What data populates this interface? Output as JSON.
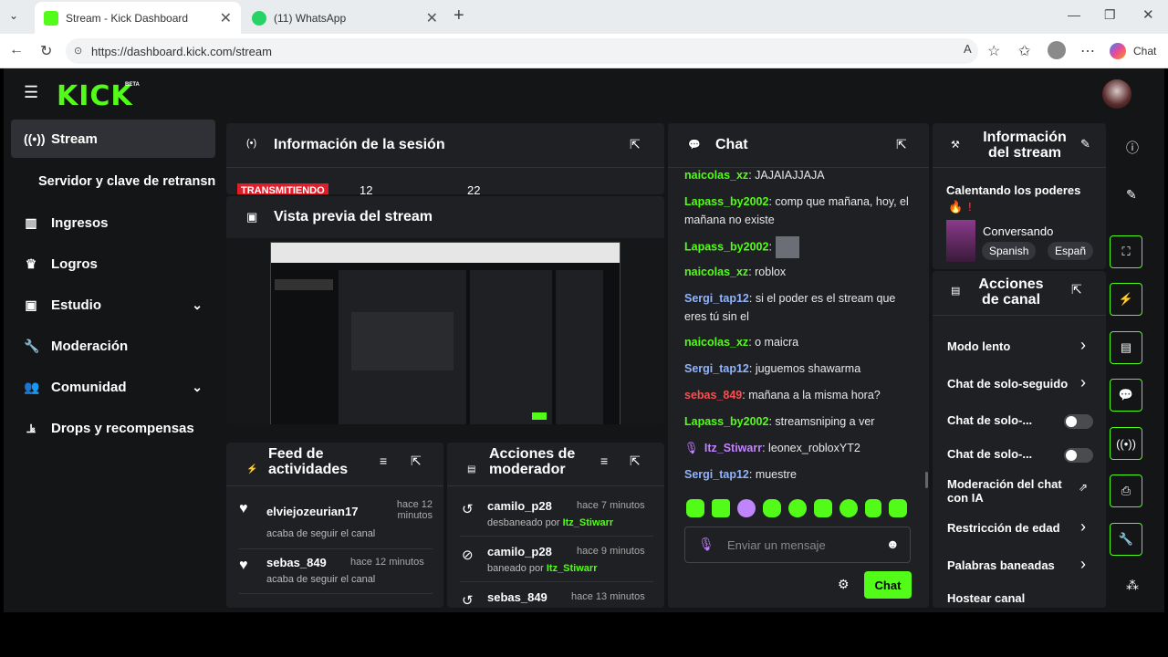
{
  "browser": {
    "tabs": [
      {
        "label": "Stream - Kick Dashboard"
      },
      {
        "label": "(11) WhatsApp"
      }
    ],
    "url": "https://dashboard.kick.com/stream",
    "copilot_label": "Chat"
  },
  "app": {
    "logo": "KICK",
    "beta": "BETA"
  },
  "sidebar": {
    "items": [
      {
        "label": "Stream",
        "icon": "broadcast-icon"
      },
      {
        "label": "Servidor y clave de retransn",
        "icon": ""
      },
      {
        "label": "Ingresos",
        "icon": "chart-icon"
      },
      {
        "label": "Logros",
        "icon": "trophy-icon"
      },
      {
        "label": "Estudio",
        "icon": "studio-icon"
      },
      {
        "label": "Moderación",
        "icon": "wrench-icon"
      },
      {
        "label": "Comunidad",
        "icon": "community-icon"
      },
      {
        "label": "Drops y recompensas",
        "icon": "drops-icon"
      }
    ]
  },
  "session": {
    "title": "Información de la sesión",
    "status": "TRANSMITIENDO",
    "stat1": "12",
    "stat2": "22"
  },
  "preview": {
    "title": "Vista previa del stream"
  },
  "feed": {
    "title": "Feed de actividades",
    "items": [
      {
        "user": "elviejozeurian17",
        "time": "hace 12 minutos",
        "action": "acaba de seguir el canal"
      },
      {
        "user": "sebas_849",
        "time": "hace 12 minutos",
        "action": "acaba de seguir el canal"
      }
    ]
  },
  "modactions": {
    "title": "Acciones de moderador",
    "items": [
      {
        "user": "camilo_p28",
        "time": "hace 7 minutos",
        "action": "desbaneado por",
        "by": "Itz_Stiwarr"
      },
      {
        "user": "camilo_p28",
        "time": "hace 9 minutos",
        "action": "baneado por",
        "by": "Itz_Stiwarr"
      },
      {
        "user": "sebas_849",
        "time": "hace 13 minutos",
        "action": "",
        "by": ""
      }
    ]
  },
  "chat": {
    "title": "Chat",
    "messages": [
      {
        "user": "naicolas_xz",
        "color": "#53fc18",
        "text": ": JAJAIAJJAJA"
      },
      {
        "user": "Lapass_by2002",
        "color": "#53fc18",
        "text": ": comp que mañana, hoy, el mañana no existe"
      },
      {
        "user": "Lapass_by2002",
        "color": "#53fc18",
        "text": ":"
      },
      {
        "user": "naicolas_xz",
        "color": "#53fc18",
        "text": ": roblox"
      },
      {
        "user": "Sergi_tap12",
        "color": "#8fb4ff",
        "text": ": si el poder es el stream que eres tú sin el"
      },
      {
        "user": "naicolas_xz",
        "color": "#53fc18",
        "text": ": o maicra"
      },
      {
        "user": "Sergi_tap12",
        "color": "#8fb4ff",
        "text": ": juguemos shawarma"
      },
      {
        "user": "sebas_849",
        "color": "#ff4d4d",
        "text": ": mañana a la misma hora?"
      },
      {
        "user": "Lapass_by2002",
        "color": "#53fc18",
        "text": ": streamsniping a ver"
      },
      {
        "user": "Itz_Stiwarr",
        "color": "#c084fc",
        "text": ": leonex_robloxYT2"
      },
      {
        "user": "Sergi_tap12",
        "color": "#8fb4ff",
        "text": ": muestre"
      }
    ],
    "input_placeholder": "Enviar un mensaje",
    "send_label": "Chat"
  },
  "streaminfo": {
    "title": "Información del stream",
    "stream_title": "Calentando los poderes",
    "category": "Conversando",
    "tags": [
      "Spanish",
      "Españ"
    ]
  },
  "channel": {
    "title": "Acciones de canal",
    "rows": [
      {
        "label": "Modo lento",
        "type": "chevron"
      },
      {
        "label": "Chat de solo-seguido",
        "type": "chevron"
      },
      {
        "label": "Chat de solo-...",
        "type": "toggle"
      },
      {
        "label": "Chat de solo-...",
        "type": "toggle"
      },
      {
        "label": "Moderación del chat con IA",
        "type": "external"
      },
      {
        "label": "Restricción de edad",
        "type": "chevron"
      },
      {
        "label": "Palabras baneadas",
        "type": "chevron"
      },
      {
        "label": "Hostear canal",
        "type": "none"
      }
    ]
  },
  "colors": {
    "accent": "#53fc18",
    "panel": "#1f2023",
    "bg": "#141517"
  }
}
